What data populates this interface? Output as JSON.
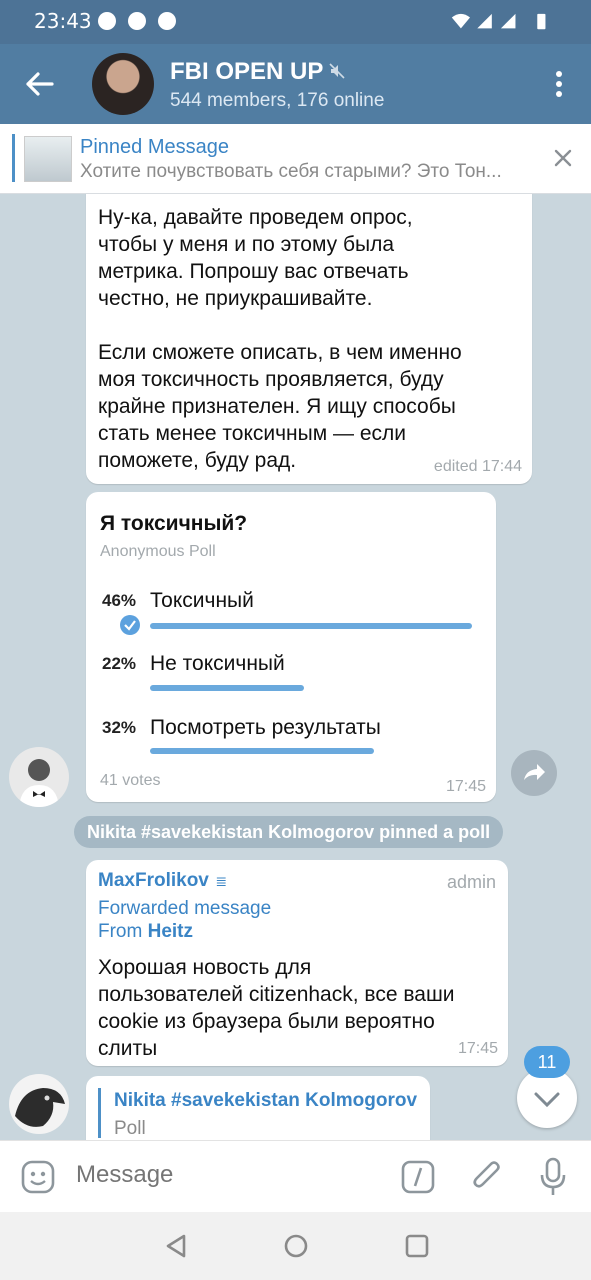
{
  "status_bar": {
    "time": "23:43"
  },
  "header": {
    "title": "FBI OPEN UP",
    "subtitle": "544 members, 176 online"
  },
  "pinned": {
    "label": "Pinned Message",
    "preview": "Хотите почувствовать себя старыми? Это Тон..."
  },
  "messages": {
    "top_text": "Ну-ка, давайте проведем опрос,\nчтобы у меня и по этому была\nметрика. Попрошу вас отвечать\nчестно, не приукрашивайте.\n\nЕсли сможете описать, в чем именно\nмоя токсичность проявляется, буду\nкрайне признателен. Я ищу способы\nстать менее токсичным — если\nпоможете, буду рад.",
    "top_time": "edited 17:44",
    "poll": {
      "question": "Я токсичный?",
      "type": "Anonymous Poll",
      "options": [
        {
          "percent": "46%",
          "text": "Токсичный",
          "fraction": 0.46,
          "chosen": true
        },
        {
          "percent": "22%",
          "text": "Не токсичный",
          "fraction": 0.22,
          "chosen": false
        },
        {
          "percent": "32%",
          "text": "Посмотреть результаты",
          "fraction": 0.32,
          "chosen": false
        }
      ],
      "votes": "41 votes",
      "time": "17:45"
    },
    "service": "Nikita #savekekistan Kolmogorov pinned a poll",
    "forward": {
      "sender": "MaxFrolikov",
      "role": "admin",
      "forwarded_label": "Forwarded message",
      "from_prefix": "From ",
      "from_name": "Heitz",
      "text": "Хорошая новость для\nпользователей citizenhack, все ваши\ncookie из браузера были вероятно\nслиты",
      "time": "17:45"
    },
    "reply": {
      "sender": "Nikita #savekekistan Kolmogorov",
      "label": "Poll"
    }
  },
  "unread_badge": "11",
  "input": {
    "placeholder": "Message"
  },
  "colors": {
    "header": "#517da2",
    "accent": "#3a84c5",
    "poll_bar": "#6aa9dd"
  }
}
